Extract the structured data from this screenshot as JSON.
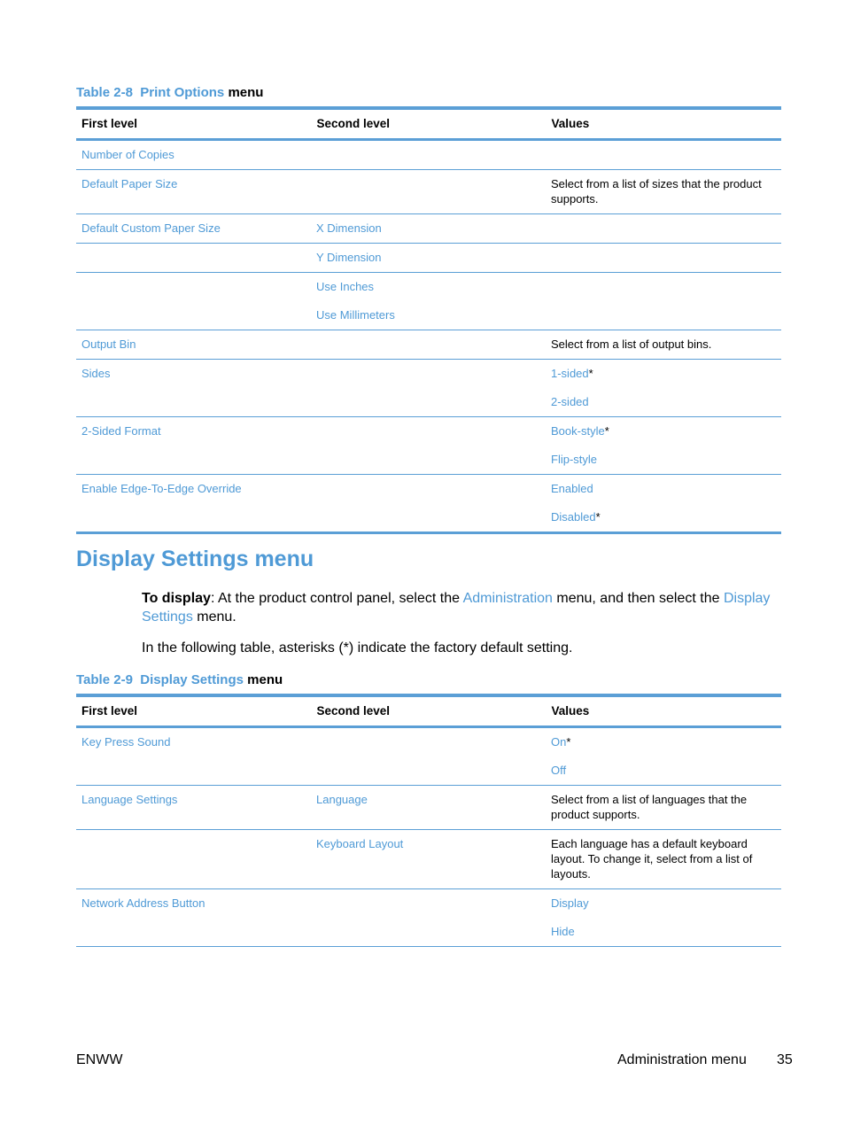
{
  "table_2_8": {
    "caption_number": "Table 2-8",
    "caption_name": "Print Options",
    "caption_suffix": "menu",
    "headers": [
      "First level",
      "Second level",
      "Values"
    ],
    "rows": [
      {
        "first": "Number of Copies",
        "second": "",
        "values": []
      },
      {
        "first": "Default Paper Size",
        "second": "",
        "values_text": "Select from a list of sizes that the product supports."
      },
      {
        "first": "Default Custom Paper Size",
        "second": "X Dimension",
        "values": []
      },
      {
        "first": "",
        "second": "Y Dimension",
        "values": []
      },
      {
        "first": "",
        "second_items": [
          "Use Inches",
          "Use Millimeters"
        ],
        "values": []
      },
      {
        "first": "Output Bin",
        "second": "",
        "values_text": "Select from a list of output bins."
      },
      {
        "first": "Sides",
        "second": "",
        "values": [
          {
            "label": "1-sided",
            "default": "*"
          },
          {
            "label": "2-sided",
            "default": ""
          }
        ]
      },
      {
        "first": "2-Sided Format",
        "second": "",
        "values": [
          {
            "label": "Book-style",
            "default": "*"
          },
          {
            "label": "Flip-style",
            "default": ""
          }
        ]
      },
      {
        "first": "Enable Edge-To-Edge Override",
        "second": "",
        "values": [
          {
            "label": "Enabled",
            "default": ""
          },
          {
            "label": "Disabled",
            "default": "*"
          }
        ]
      }
    ]
  },
  "section": {
    "title": "Display Settings menu",
    "intro": {
      "bold_lead": "To display",
      "text1": ": At the product control panel, select the ",
      "link1": "Administration",
      "text2": " menu, and then select the ",
      "link2": "Display Settings",
      "text3": " menu."
    },
    "note": "In the following table, asterisks (*) indicate the factory default setting."
  },
  "table_2_9": {
    "caption_number": "Table 2-9",
    "caption_name": "Display Settings",
    "caption_suffix": "menu",
    "headers": [
      "First level",
      "Second level",
      "Values"
    ],
    "rows": [
      {
        "first": "Key Press Sound",
        "second": "",
        "values": [
          {
            "label": "On",
            "default": "*"
          },
          {
            "label": "Off",
            "default": ""
          }
        ]
      },
      {
        "first": "Language Settings",
        "second": "Language",
        "values_text": "Select from a list of languages that the product supports."
      },
      {
        "first": "",
        "second": "Keyboard Layout",
        "values_text": "Each language has a default keyboard layout. To change it, select from a list of layouts."
      },
      {
        "first": "Network Address Button",
        "second": "",
        "values": [
          {
            "label": "Display",
            "default": ""
          },
          {
            "label": "Hide",
            "default": ""
          }
        ]
      }
    ]
  },
  "footer": {
    "left": "ENWW",
    "section": "Administration menu",
    "page": "35"
  },
  "colors": {
    "accent": "#4f9ad6",
    "rule": "#5b9fd6",
    "text": "#000000"
  }
}
